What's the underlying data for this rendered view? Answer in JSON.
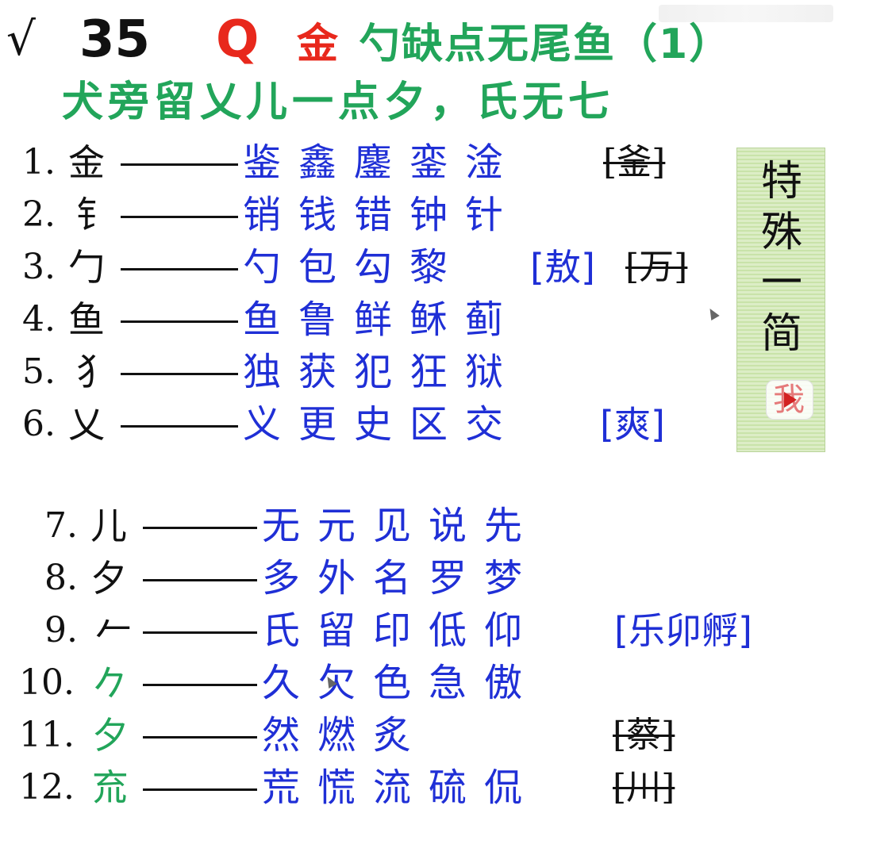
{
  "header": {
    "check_mark": "√",
    "lesson_number": "35",
    "q_badge": "Q",
    "title_red": "金",
    "title_green": "勺缺点无尾鱼（1）",
    "subtitle": "犬旁留乂儿一点夕，氏无七"
  },
  "rows": [
    {
      "num": "1.",
      "radical": "金",
      "chars": "鉴鑫鏖銮淦",
      "bracket": "",
      "strike": "[釜]"
    },
    {
      "num": "2.",
      "radical": "钅",
      "chars": "销钱错钟针",
      "bracket": "",
      "strike": ""
    },
    {
      "num": "3.",
      "radical": "勹",
      "chars": "勺包勾黎",
      "bracket": "[敖]",
      "strike": "[万]"
    },
    {
      "num": "4.",
      "radical": "鱼",
      "chars": "鱼鲁鲜稣蓟",
      "bracket": "",
      "strike": ""
    },
    {
      "num": "5.",
      "radical": "犭",
      "chars": "独获犯狂狱",
      "bracket": "",
      "strike": ""
    },
    {
      "num": "6.",
      "radical": "乂",
      "chars": "义更史区交",
      "bracket": "[爽]",
      "strike": ""
    },
    {
      "num": "7.",
      "radical": "儿",
      "chars": "无元见说先",
      "bracket": "",
      "strike": ""
    },
    {
      "num": "8.",
      "radical": "夕",
      "chars": "多外名罗梦",
      "bracket": "",
      "strike": ""
    },
    {
      "num": "9.",
      "radical": "𠂉",
      "chars": "氏留印低仰",
      "bracket": "[乐卯孵]",
      "strike": ""
    },
    {
      "num": "10.",
      "radical": "𠂊",
      "chars": "久欠色急傲",
      "bracket": "",
      "strike": ""
    },
    {
      "num": "11.",
      "radical": "夕",
      "chars": "然燃炙",
      "bracket": "",
      "strike": "[蔡]"
    },
    {
      "num": "12.",
      "radical": "㐬",
      "chars": "荒慌流硫侃",
      "bracket": "",
      "strike": "[川]"
    }
  ],
  "side_panel": {
    "chars": [
      "特",
      "殊",
      "一",
      "简",
      ":"
    ],
    "badge_char": "我"
  },
  "colors": {
    "title_red": "#e8281c",
    "title_green": "#22a55a",
    "chars_blue": "#1f2fd6",
    "panel_green": "#c9e3a9"
  },
  "icons": {
    "play": "play-icon",
    "cursor": "cursor-icon"
  }
}
